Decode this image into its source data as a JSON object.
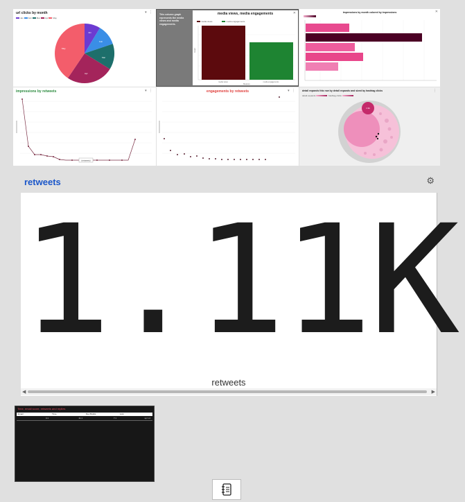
{
  "tiles": {
    "pie": {
      "title": "url clicks by month",
      "tools": "▾ ⋮",
      "legend": [
        "Jan",
        "Feb",
        "Mar",
        "Apr",
        "May"
      ],
      "colors": [
        "#6c3bd1",
        "#3a8ee6",
        "#1d6f6b",
        "#a4245b",
        "#f35d6b"
      ],
      "slice_labels": [
        "Jan",
        "Feb",
        "Mar",
        "Apr",
        "May"
      ]
    },
    "media": {
      "title": "media views, media engagements",
      "info_text": "This column graph represents the media views and media engagements.",
      "legend": [
        "media views",
        "media engagements"
      ],
      "categories": [
        "media views",
        "media engagements"
      ],
      "colors": [
        "#5c0a0d",
        "#1e8432"
      ],
      "xlabel": "Measure",
      "ylabel": "Count"
    },
    "impressions_month": {
      "title": "impressions by month colored by impressions",
      "colors": [
        "#e84a8f",
        "#4b0024",
        "#ee5d9d",
        "#e8468a",
        "#f07fb3"
      ]
    },
    "impressions_retweets": {
      "title": "impressions by retweets",
      "tools": "▾ ⋮",
      "tooltip": "(retweets)",
      "line_color": "#7a2e45"
    },
    "engagements_retweets": {
      "title": "engagements by retweets",
      "tools": "▾ ⋮",
      "marker_color": "#5a2233"
    },
    "bubble": {
      "title": "detail expands this row by detail expands and sized by hashtag clicks",
      "tools": "⋮",
      "legend_labels": [
        "detail expands",
        "hashtag clicks"
      ],
      "center_label": "1.9k"
    }
  },
  "retweets_kpi": {
    "title": "retweets",
    "value": "1.11K",
    "label": "retweets",
    "gear_icon": "gear-icon",
    "scroll_left": "◀",
    "scroll_right": "▶"
  },
  "table_tile": {
    "title": "Time, email score, retweets and replies",
    "columns": [
      "Email",
      "Time",
      "Dev Builds",
      "Link"
    ],
    "row": [
      "4.1",
      "11.1",
      "7.1",
      "up 1.2"
    ]
  },
  "toolbar": {
    "notebook_icon": "notebook-icon"
  }
}
